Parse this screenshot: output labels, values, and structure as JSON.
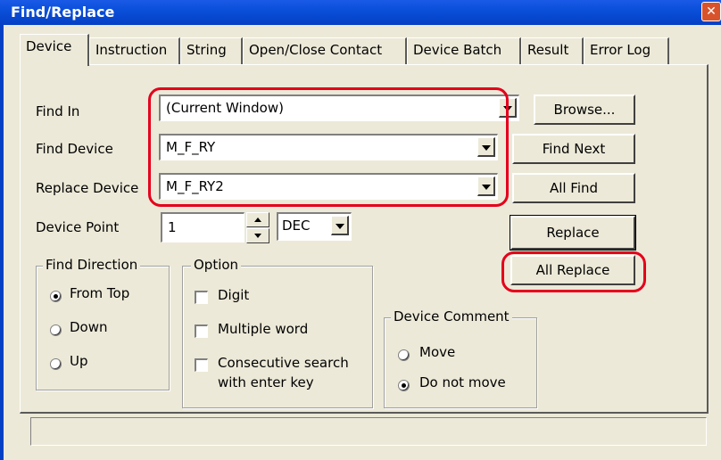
{
  "window": {
    "title": "Find/Replace",
    "close_glyph": "✕"
  },
  "tabs": [
    {
      "label": "Device",
      "active": true
    },
    {
      "label": "Instruction"
    },
    {
      "label": "String"
    },
    {
      "label": "Open/Close Contact"
    },
    {
      "label": "Device Batch"
    },
    {
      "label": "Result"
    },
    {
      "label": "Error Log"
    }
  ],
  "fields": {
    "find_in": {
      "label": "Find In",
      "value": "(Current Window)"
    },
    "find_device": {
      "label": "Find Device",
      "value": "M_F_RY"
    },
    "replace_device": {
      "label": "Replace Device",
      "value": "M_F_RY2"
    },
    "device_point": {
      "label": "Device Point",
      "value": "1",
      "radix": "DEC"
    }
  },
  "buttons": {
    "browse": "Browse...",
    "find_next": "Find Next",
    "all_find": "All Find",
    "replace": "Replace",
    "all_replace": "All Replace"
  },
  "find_direction": {
    "title": "Find Direction",
    "options": [
      "From Top",
      "Down",
      "Up"
    ],
    "selected": "From Top"
  },
  "option": {
    "title": "Option",
    "digit": "Digit",
    "multiple_word": "Multiple word",
    "consecutive_line1": "Consecutive search",
    "consecutive_line2": "with enter key"
  },
  "device_comment": {
    "title": "Device Comment",
    "options": [
      "Move",
      "Do not move"
    ],
    "selected": "Do not move"
  },
  "highlight_color": "#e4001b"
}
